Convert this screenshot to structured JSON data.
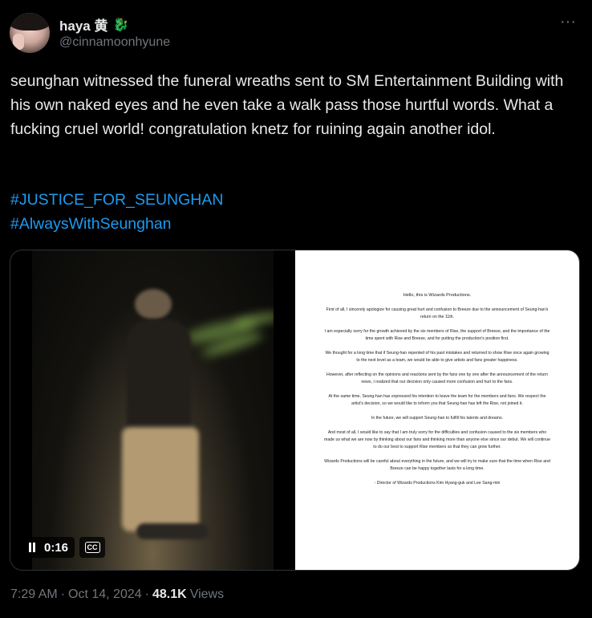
{
  "author": {
    "display_name": "haya 黄",
    "name_emoji": "🐉",
    "handle": "@cinnamoonhyune"
  },
  "more_label": "···",
  "tweet": {
    "text": "seunghan witnessed the funeral wreaths sent to SM Entertainment Building with his own naked eyes and he even take a walk pass those hurtful words. What a fucking cruel world! congratulation knetz for ruining again another idol.",
    "hashtags": [
      "#JUSTICE_FOR_SEUNGHAN",
      "#AlwaysWithSeunghan"
    ]
  },
  "video": {
    "time": "0:16",
    "cc_label": "CC"
  },
  "statement": {
    "title": "Hello, this is Wizards Productions.",
    "paragraphs": [
      "First of all, I sincerely apologize for causing great hurt and confusion to Breeze due to the announcement of Seung-han's return on the 11th.",
      "I am especially sorry for the growth achieved by the six members of Rise, the support of Breeze, and the importance of the time spent with Rise and Breeze, and for putting the production's position first.",
      "",
      "We thought for a long time that if Seung-han repented of his past mistakes and returned to show Rise once again growing to the next level as a team, we would be able to give artists and fans greater happiness.",
      "However, after reflecting on the opinions and reactions sent by the fans one by one after the announcement of the return news, I realized that our decision only caused more confusion and hurt to the fans.",
      "At the same time, Seung-han has expressed his intention to leave the team for the members and fans. We respect the artist's decision, so we would like to inform you that Seung-han has left the Rise, not joined it.",
      "In the future, we will support Seung-han to fulfill his talents and dreams.",
      "And most of all, I would like to say that I am truly sorry for the difficulties and confusion caused to the six members who made us what we are now by thinking about our fans and thinking more than anyone else since our debut. We will continue to do our best to support Rise members so that they can grow further.",
      "Wizards Productions will be careful about everything in the future, and we will try to make sure that the time when Rise and Breeze can be happy together lasts for a long time.",
      "- Director of Wizards Productions Kim Hyang-guk and Lee Sang-min"
    ]
  },
  "meta": {
    "time": "7:29 AM",
    "separator": "·",
    "date": "Oct 14, 2024",
    "views_count": "48.1K",
    "views_label": "Views"
  },
  "colors": {
    "background": "#000000",
    "text": "#e7e9ea",
    "secondary": "#71767b",
    "link": "#1d9bf0"
  }
}
